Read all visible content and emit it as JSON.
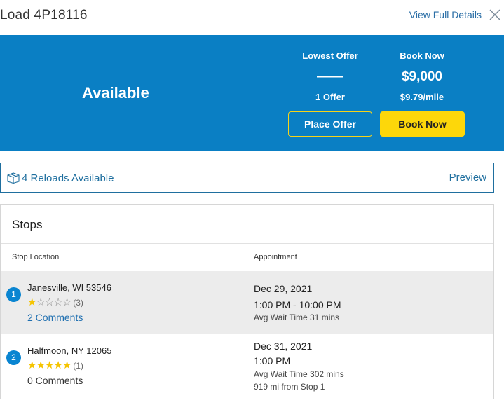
{
  "header": {
    "title": "Load 4P18116",
    "view_details_label": "View Full Details",
    "close_icon": "close-icon"
  },
  "banner": {
    "status": "Available",
    "lowest_offer": {
      "label": "Lowest Offer",
      "value": "——",
      "sub": "1 Offer"
    },
    "book_now": {
      "label": "Book Now",
      "value": "$9,000",
      "sub": "$9.79/mile"
    },
    "place_offer_button": "Place Offer",
    "book_now_button": "Book Now",
    "colors": {
      "background": "#0a7fc4",
      "book_button": "#fdd70a",
      "offer_border": "#f7d319"
    }
  },
  "reloads": {
    "icon": "box-icon",
    "label": "4 Reloads Available",
    "preview": "Preview"
  },
  "stops": {
    "title": "Stops",
    "columns": [
      "Stop Location",
      "Appointment"
    ],
    "rows": [
      {
        "number": "1",
        "location": "Janesville, WI 53546",
        "rating": 1,
        "rating_max": 5,
        "rating_count": "(3)",
        "comments": "2 Comments",
        "date": "Dec 29, 2021",
        "time": "1:00 PM - 10:00 PM",
        "wait": "Avg Wait Time 31 mins",
        "distance": ""
      },
      {
        "number": "2",
        "location": "Halfmoon, NY 12065",
        "rating": 5,
        "rating_max": 5,
        "rating_count": "(1)",
        "comments": "0 Comments",
        "date": "Dec 31, 2021",
        "time": "1:00 PM",
        "wait": "Avg Wait Time 302 mins",
        "distance": "919 mi from Stop 1"
      }
    ]
  }
}
